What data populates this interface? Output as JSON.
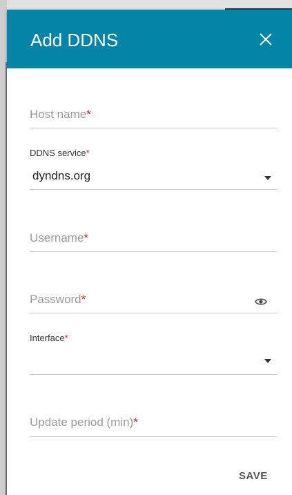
{
  "dialog": {
    "title": "Add DDNS",
    "save_label": "SAVE"
  },
  "fields": {
    "host_name": {
      "label": "Host name",
      "required_mark": "*"
    },
    "ddns_service": {
      "label": "DDNS service",
      "required_mark": "*",
      "value": "dyndns.org"
    },
    "username": {
      "label": "Username",
      "required_mark": "*"
    },
    "password": {
      "label": "Password",
      "required_mark": "*"
    },
    "interface": {
      "label": "Interface",
      "required_mark": "*",
      "value": ""
    },
    "update_period": {
      "label": "Update period (min)",
      "required_mark": "*"
    }
  },
  "icons": {
    "close": "close-icon",
    "dropdown": "chevron-down-icon",
    "show_password": "eye-icon"
  },
  "colors": {
    "header": "#0485a8",
    "required": "#d0281b",
    "placeholder": "#9a9a9a"
  }
}
